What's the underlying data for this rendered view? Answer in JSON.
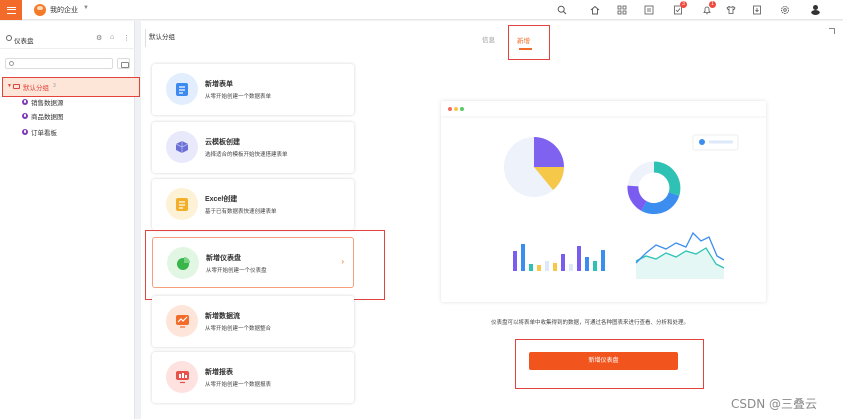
{
  "topbar": {
    "org_name": "我的企业",
    "tools": [
      {
        "icon": "search-icon"
      },
      {
        "icon": "home-icon"
      },
      {
        "icon": "apps-icon"
      },
      {
        "icon": "form-icon"
      },
      {
        "icon": "approval-icon",
        "badge": "3"
      },
      {
        "icon": "notification-icon",
        "badge": "1"
      },
      {
        "icon": "shirt-icon"
      },
      {
        "icon": "download-icon"
      },
      {
        "icon": "settings-icon"
      }
    ]
  },
  "sidebar": {
    "title": "仪表盘",
    "search_placeholder": "",
    "group": {
      "label": "默认分组",
      "count": "3"
    },
    "items": [
      {
        "label": "销售数据源"
      },
      {
        "label": "商品数据图"
      },
      {
        "label": "订单看板"
      }
    ]
  },
  "main": {
    "group_tab": "默认分组",
    "tabs": {
      "info": "信息",
      "new": "新增"
    },
    "cards": [
      {
        "title": "新增表单",
        "desc": "从零开始创建一个数据表单",
        "icon": "form-icon",
        "color": "#3c8af0",
        "bg": "#e2eefe"
      },
      {
        "title": "云模板创建",
        "desc": "选择适合的模板开始快速搭建表单",
        "icon": "cube-icon",
        "color": "#6a6fd6",
        "bg": "#e8e9fb"
      },
      {
        "title": "Excel创建",
        "desc": "基于已有数据表快速创建表单",
        "icon": "excel-icon",
        "color": "#f2b02a",
        "bg": "#fdf1d6"
      },
      {
        "title": "新增仪表盘",
        "desc": "从零开始创建一个仪表盘",
        "icon": "pie-chart-icon",
        "color": "#39b54a",
        "bg": "#e2f6e4"
      },
      {
        "title": "新增数据流",
        "desc": "从零开始创建一个数据整合",
        "icon": "dataflow-icon",
        "color": "#f26b2a",
        "bg": "#fde6d9"
      },
      {
        "title": "新增报表",
        "desc": "从零开始创建一个数据报表",
        "icon": "report-icon",
        "color": "#e8504a",
        "bg": "#fde2e0"
      }
    ],
    "preview_description": "仪表盘可以将表单中收集得到的数据，可通过各种图表来进行查看、分析和处理。",
    "create_button": "新增仪表盘"
  },
  "colors": {
    "accent": "#f26b2a",
    "highlight": "#e2433c",
    "series": [
      "#7b5cf0",
      "#f5c84a",
      "#2fc2b4",
      "#3b8ef0"
    ]
  },
  "watermark": "CSDN @三叠云"
}
